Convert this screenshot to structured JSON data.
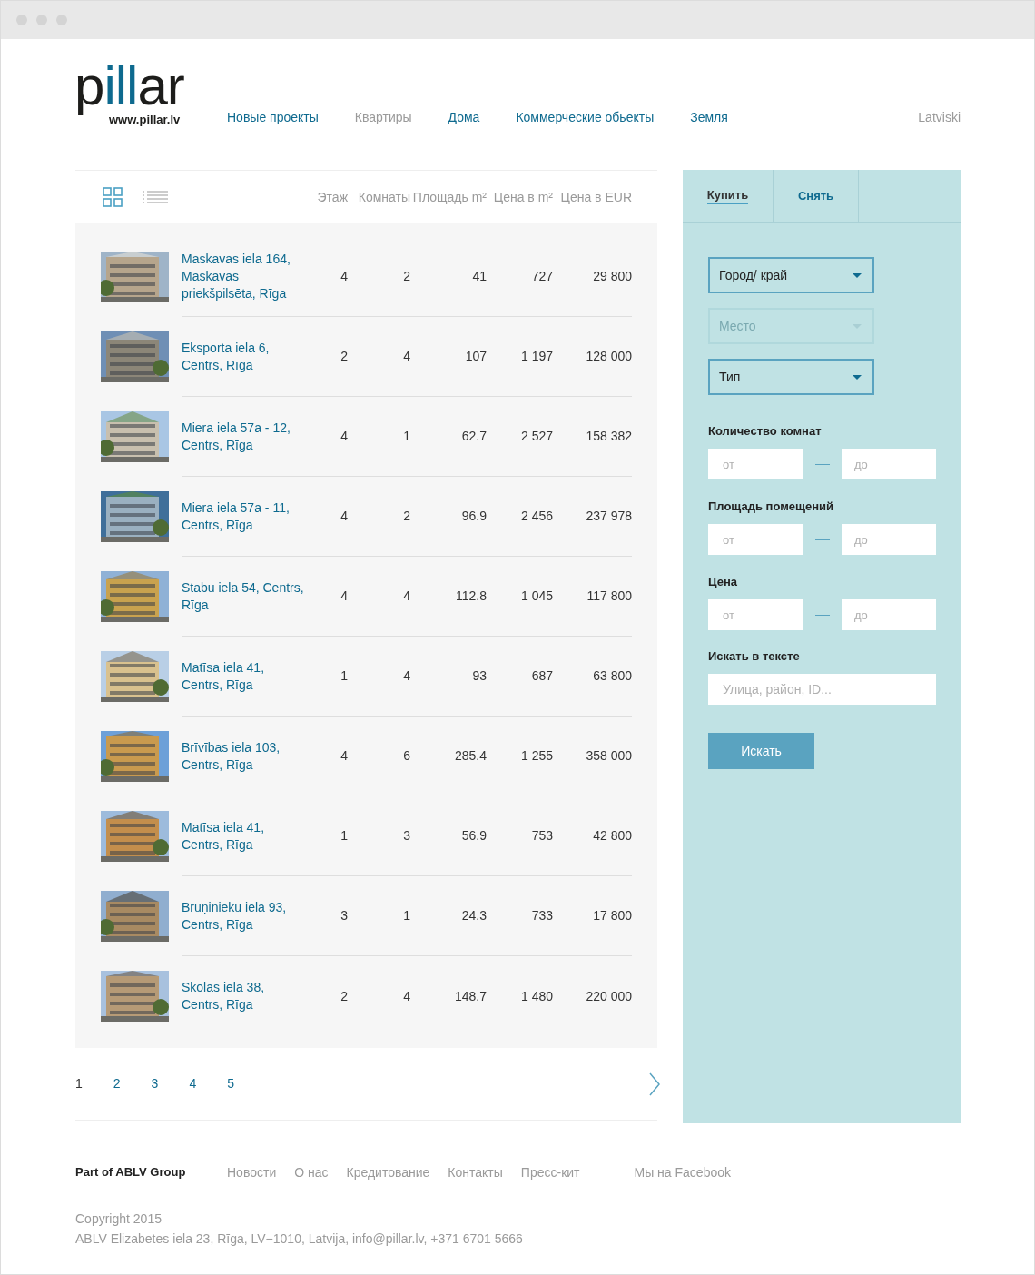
{
  "logo": {
    "text": "pillar",
    "url": "www.pillar.lv"
  },
  "nav": [
    {
      "label": "Новые проекты",
      "selected": false
    },
    {
      "label": "Квартиры",
      "selected": true
    },
    {
      "label": "Дома",
      "selected": false
    },
    {
      "label": "Коммерческие обьекты",
      "selected": false
    },
    {
      "label": "Земля",
      "selected": false
    }
  ],
  "language": "Latviski",
  "view_toggle": [
    {
      "kind": "grid",
      "selected": false
    },
    {
      "kind": "list",
      "selected": true
    }
  ],
  "columns": [
    "Этаж",
    "Комнаты",
    "Площадь m²",
    "Цена в m²",
    "Цена в EUR"
  ],
  "listings": [
    {
      "address": "Maskavas iela 164, Maskavas priekšpilsēta, Rīga",
      "floor": "4",
      "rooms": "2",
      "area": "41",
      "price_per_m2": "727",
      "price": "29 800"
    },
    {
      "address": "Eksporta iela 6, Centrs, Rīga",
      "floor": "2",
      "rooms": "4",
      "area": "107",
      "price_per_m2": "1 197",
      "price": "128 000"
    },
    {
      "address": "Miera iela 57a - 12, Centrs, Rīga",
      "floor": "4",
      "rooms": "1",
      "area": "62.7",
      "price_per_m2": "2 527",
      "price": "158 382"
    },
    {
      "address": "Miera iela 57a - 11, Centrs, Rīga",
      "floor": "4",
      "rooms": "2",
      "area": "96.9",
      "price_per_m2": "2 456",
      "price": "237 978"
    },
    {
      "address": "Stabu iela 54, Centrs, Rīga",
      "floor": "4",
      "rooms": "4",
      "area": "112.8",
      "price_per_m2": "1 045",
      "price": "117 800"
    },
    {
      "address": "Matīsa iela 41, Centrs, Rīga",
      "floor": "1",
      "rooms": "4",
      "area": "93",
      "price_per_m2": "687",
      "price": "63 800"
    },
    {
      "address": "Brīvības iela 103, Centrs, Rīga",
      "floor": "4",
      "rooms": "6",
      "area": "285.4",
      "price_per_m2": "1 255",
      "price": "358 000"
    },
    {
      "address": "Matīsa iela 41, Centrs, Rīga",
      "floor": "1",
      "rooms": "3",
      "area": "56.9",
      "price_per_m2": "753",
      "price": "42 800"
    },
    {
      "address": "Bruņinieku iela 93, Centrs, Rīga",
      "floor": "3",
      "rooms": "1",
      "area": "24.3",
      "price_per_m2": "733",
      "price": "17 800"
    },
    {
      "address": "Skolas iela 38, Centrs, Rīga",
      "floor": "2",
      "rooms": "4",
      "area": "148.7",
      "price_per_m2": "1 480",
      "price": "220 000"
    }
  ],
  "pagination": [
    {
      "label": "1",
      "selected": true
    },
    {
      "label": "2",
      "selected": false
    },
    {
      "label": "3",
      "selected": false
    },
    {
      "label": "4",
      "selected": false
    },
    {
      "label": "5",
      "selected": false
    }
  ],
  "sidebar": {
    "tabs": [
      {
        "label": "Купить",
        "selected": true
      },
      {
        "label": "Снять",
        "selected": false
      }
    ],
    "selects": [
      {
        "label": "Город/ край",
        "disabled": false
      },
      {
        "label": "Место",
        "disabled": true
      },
      {
        "label": "Тип",
        "disabled": false
      }
    ],
    "ranges": [
      {
        "label": "Количество комнат",
        "fields": [
          {
            "placeholder": "от"
          },
          {
            "placeholder": "до"
          }
        ]
      },
      {
        "label": "Площадь помещений",
        "fields": [
          {
            "placeholder": "от"
          },
          {
            "placeholder": "до"
          }
        ]
      },
      {
        "label": "Цена",
        "fields": [
          {
            "placeholder": "от"
          },
          {
            "placeholder": "до"
          }
        ]
      }
    ],
    "text_search": {
      "label": "Искать в тексте",
      "placeholder": "Улица, район, ID..."
    },
    "submit": "Искать"
  },
  "footer": {
    "group": "Part of ABLV Group",
    "links": [
      "Новости",
      "О нас",
      "Кредитование",
      "Контакты",
      "Пресс-кит"
    ],
    "facebook": "Мы на Facebook",
    "copyright": "Copyright 2015",
    "address": "ABLV Elizabetes iela 23, Rīga, LV−1010, Latvija, info@pillar.lv, +371 6701 5666"
  }
}
